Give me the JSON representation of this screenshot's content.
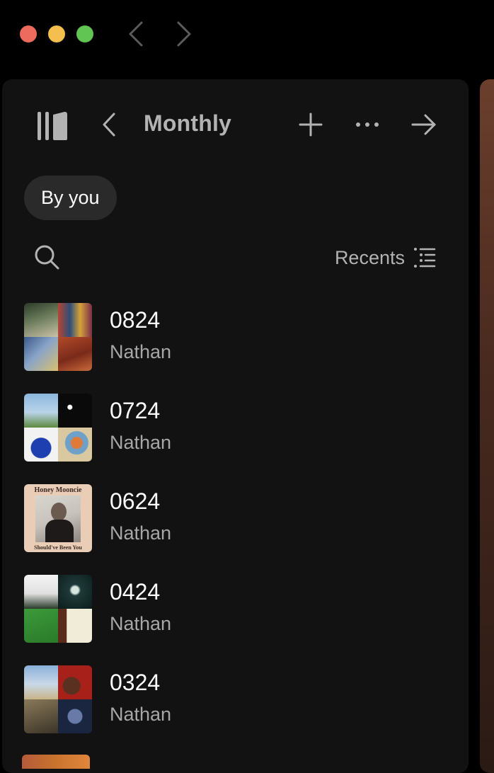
{
  "window": {
    "controls": [
      "close",
      "minimize",
      "zoom"
    ],
    "nav": [
      "back-icon",
      "forward-icon"
    ]
  },
  "library": {
    "title": "Monthly",
    "filter_chip": "By you",
    "sort_label": "Recents",
    "icons": [
      "library-icon",
      "chevron-left-icon",
      "plus-icon",
      "more-icon",
      "arrow-right-icon",
      "search-icon",
      "list-icon"
    ]
  },
  "playlists": [
    {
      "title": "0824",
      "owner": "Nathan"
    },
    {
      "title": "0724",
      "owner": "Nathan"
    },
    {
      "title": "0624",
      "owner": "Nathan",
      "cover_text_top": "Honey Mooncie",
      "cover_text_bottom": "Should've Been You"
    },
    {
      "title": "0424",
      "owner": "Nathan"
    },
    {
      "title": "0324",
      "owner": "Nathan"
    }
  ],
  "colors": {
    "background": "#000000",
    "panel": "#121212",
    "chip": "#2a2a2a",
    "text_primary": "#ffffff",
    "text_secondary": "#a7a7a7"
  }
}
